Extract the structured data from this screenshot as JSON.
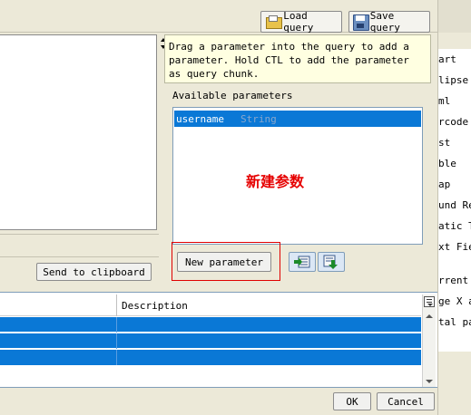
{
  "toolbar": {
    "load_query": "Load query",
    "save_query": "Save query"
  },
  "hint": {
    "text": "Drag a parameter into the query to add a parameter. Hold CTL to add the parameter as query chunk."
  },
  "parameters": {
    "title": "Available parameters",
    "items": [
      {
        "name": "username",
        "type": "String"
      }
    ],
    "new_button": "New parameter",
    "annotation": "新建参数"
  },
  "left": {
    "send_to_clipboard": "Send to clipboard"
  },
  "table": {
    "column_description": "Description"
  },
  "right_sidebar": {
    "items": [
      "art",
      "lipse",
      "ml",
      "rcode",
      "st",
      "ble",
      "ap",
      "und Re",
      "atic T",
      "xt Fie"
    ],
    "lower_items": [
      "rrent",
      "ge X a",
      "tal pa"
    ]
  },
  "footer": {
    "ok": "OK",
    "cancel": "Cancel"
  },
  "colors": {
    "selection": "#0a78d6",
    "hint_bg": "#ffffe1",
    "annotation": "#e60000"
  }
}
